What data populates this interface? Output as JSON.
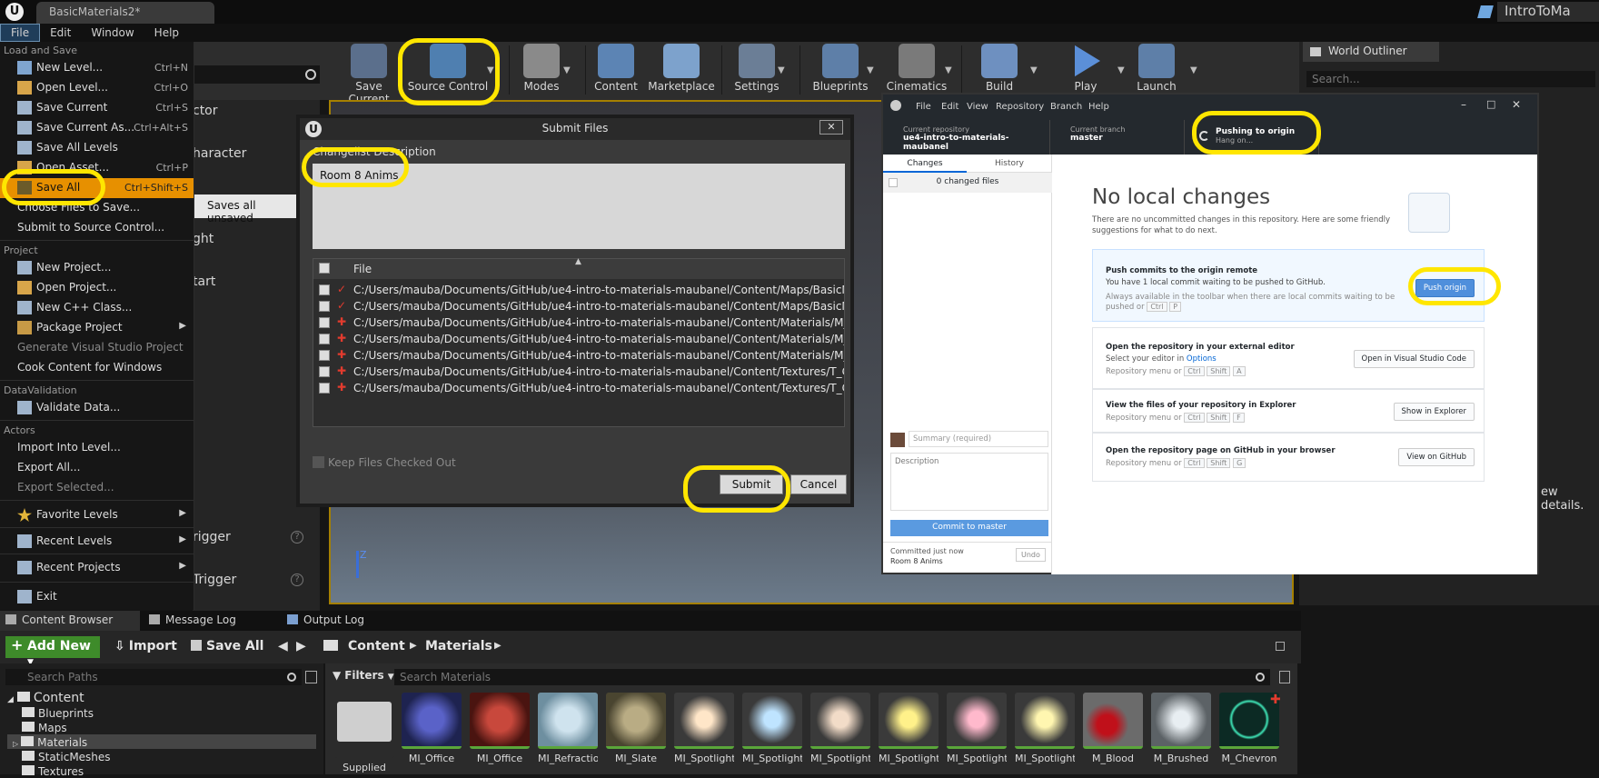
{
  "window": {
    "tab_title": "BasicMaterials2*",
    "project_name": "IntroToMa"
  },
  "menubar": [
    "File",
    "Edit",
    "Window",
    "Help"
  ],
  "toolbar": {
    "items": [
      "Save Current",
      "Source Control",
      "Modes",
      "Content",
      "Marketplace",
      "Settings",
      "Blueprints",
      "Cinematics",
      "Build",
      "Play",
      "Launch"
    ]
  },
  "file_menu": {
    "sections": [
      "Load and Save",
      "Project",
      "DataValidation",
      "Actors"
    ],
    "load_save": [
      {
        "label": "New Level...",
        "shortcut": "Ctrl+N"
      },
      {
        "label": "Open Level...",
        "shortcut": "Ctrl+O"
      },
      {
        "label": "Save Current",
        "shortcut": "Ctrl+S"
      },
      {
        "label": "Save Current As...",
        "shortcut": "Ctrl+Alt+S"
      },
      {
        "label": "Save All Levels",
        "shortcut": ""
      },
      {
        "label": "Open Asset...",
        "shortcut": "Ctrl+P"
      },
      {
        "label": "Save All",
        "shortcut": "Ctrl+Shift+S"
      },
      {
        "label": "Choose Files to Save...",
        "shortcut": ""
      },
      {
        "label": "Submit to Source Control...",
        "shortcut": ""
      }
    ],
    "project": [
      "New Project...",
      "Open Project...",
      "New C++ Class...",
      "Package Project",
      "Generate Visual Studio Project",
      "Cook Content for Windows"
    ],
    "datavalidation": [
      "Validate Data..."
    ],
    "actors": [
      "Import Into Level...",
      "Export All...",
      "Export Selected..."
    ],
    "bottom": [
      "Favorite Levels",
      "Recent Levels",
      "Recent Projects",
      "Exit"
    ],
    "tooltip": "Saves all unsaved"
  },
  "modes_panel": {
    "items": [
      "ctor",
      "haracter",
      "ght",
      "tart",
      "rigger",
      "Trigger"
    ]
  },
  "submit_dialog": {
    "title": "Submit Files",
    "changelist_label": "Changelist Description",
    "changelist_text": "Room 8 Anims",
    "file_header": "File",
    "files": [
      {
        "status": "check",
        "path": "C:/Users/mauba/Documents/GitHub/ue4-intro-to-materials-maubanel/Content/Maps/BasicMateri"
      },
      {
        "status": "check",
        "path": "C:/Users/mauba/Documents/GitHub/ue4-intro-to-materials-maubanel/Content/Maps/BasicMateri"
      },
      {
        "status": "add",
        "path": "C:/Users/mauba/Documents/GitHub/ue4-intro-to-materials-maubanel/Content/Materials/M_Chevro"
      },
      {
        "status": "add",
        "path": "C:/Users/mauba/Documents/GitHub/ue4-intro-to-materials-maubanel/Content/Materials/M_Circle"
      },
      {
        "status": "add",
        "path": "C:/Users/mauba/Documents/GitHub/ue4-intro-to-materials-maubanel/Content/Materials/M_Glow."
      },
      {
        "status": "add",
        "path": "C:/Users/mauba/Documents/GitHub/ue4-intro-to-materials-maubanel/Content/Textures/T_Chevro"
      },
      {
        "status": "add",
        "path": "C:/Users/mauba/Documents/GitHub/ue4-intro-to-materials-maubanel/Content/Textures/T_Circula"
      }
    ],
    "keep_checked_out": "Keep Files Checked Out",
    "submit": "Submit",
    "cancel": "Cancel"
  },
  "github": {
    "menu": [
      "File",
      "Edit",
      "View",
      "Repository",
      "Branch",
      "Help"
    ],
    "current_repo_label": "Current repository",
    "current_repo": "ue4-intro-to-materials-maubanel",
    "current_branch_label": "Current branch",
    "current_branch": "master",
    "push_title": "Pushing to origin",
    "push_sub": "Hang on...",
    "tabs": [
      "Changes",
      "History"
    ],
    "changed_files": "0 changed files",
    "summary_placeholder": "Summary (required)",
    "description_placeholder": "Description",
    "commit_button": "Commit to master",
    "committed_label": "Committed just now",
    "committed_msg": "Room 8 Anims",
    "undo": "Undo",
    "no_changes_title": "No local changes",
    "no_changes_sub": "There are no uncommitted changes in this repository. Here are some friendly suggestions for what to do next.",
    "push_card": {
      "title": "Push commits to the origin remote",
      "line1": "You have 1 local commit waiting to be pushed to GitHub.",
      "line2": "Always available in the toolbar when there are local commits waiting to be pushed or",
      "keys": [
        "Ctrl",
        "P"
      ],
      "button": "Push origin"
    },
    "editor_card": {
      "title": "Open the repository in your external editor",
      "line1": "Select your editor in",
      "link": "Options",
      "line2": "Repository menu or",
      "keys": [
        "Ctrl",
        "Shift",
        "A"
      ],
      "button": "Open in Visual Studio Code"
    },
    "explorer_card": {
      "title": "View the files of your repository in Explorer",
      "line2": "Repository menu or",
      "keys": [
        "Ctrl",
        "Shift",
        "F"
      ],
      "button": "Show in Explorer"
    },
    "web_card": {
      "title": "Open the repository page on GitHub in your browser",
      "line2": "Repository menu or",
      "keys": [
        "Ctrl",
        "Shift",
        "G"
      ],
      "button": "View on GitHub"
    }
  },
  "outliner": {
    "title": "World Outliner",
    "search_placeholder": "Search...",
    "details_hint": "ew details."
  },
  "content_browser": {
    "tabs": [
      "Content Browser",
      "Message Log",
      "Output Log"
    ],
    "add_new": "Add New",
    "import": "Import",
    "save_all": "Save All",
    "breadcrumb": [
      "Content",
      "Materials"
    ],
    "search_paths": "Search Paths",
    "filters": "Filters",
    "search_materials": "Search Materials",
    "tree": [
      "Content",
      "Blueprints",
      "Maps",
      "Materials",
      "StaticMeshes",
      "Textures"
    ],
    "assets": [
      "Supplied",
      "MI_Office",
      "MI_Office",
      "MI_Refraction",
      "MI_Slate",
      "MI_Spotlight_",
      "MI_Spotlight_",
      "MI_Spotlight_",
      "MI_Spotlight_",
      "MI_Spotlight_",
      "MI_Spotlight_",
      "M_Blood",
      "M_Brushed",
      "M_Chevron"
    ]
  }
}
